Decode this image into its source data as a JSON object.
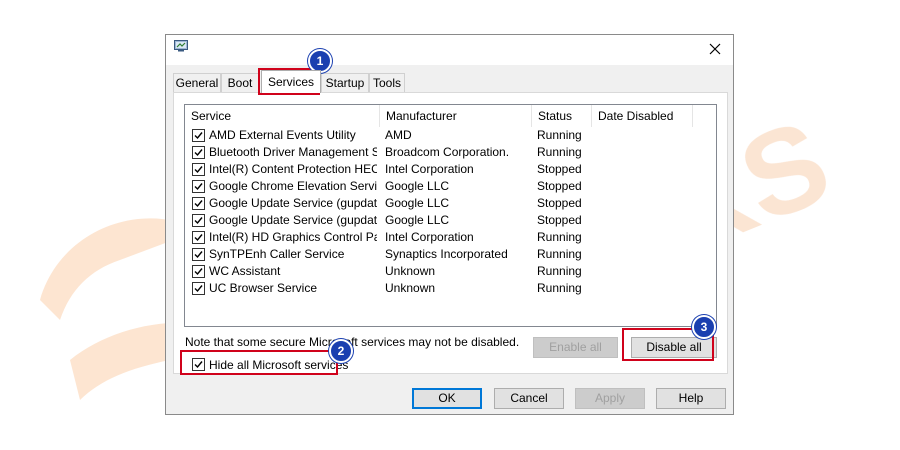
{
  "dialog": {
    "tabs": [
      {
        "label": "General"
      },
      {
        "label": "Boot"
      },
      {
        "label": "Services"
      },
      {
        "label": "Startup"
      },
      {
        "label": "Tools"
      }
    ],
    "columns": [
      "Service",
      "Manufacturer",
      "Status",
      "Date Disabled"
    ],
    "services": [
      {
        "name": "AMD External Events Utility",
        "manufacturer": "AMD",
        "status": "Running",
        "checked": true
      },
      {
        "name": "Bluetooth Driver Management S...",
        "manufacturer": "Broadcom Corporation.",
        "status": "Running",
        "checked": true
      },
      {
        "name": "Intel(R) Content Protection HEC...",
        "manufacturer": "Intel Corporation",
        "status": "Stopped",
        "checked": true
      },
      {
        "name": "Google Chrome Elevation Servic...",
        "manufacturer": "Google LLC",
        "status": "Stopped",
        "checked": true
      },
      {
        "name": "Google Update Service (gupdate)",
        "manufacturer": "Google LLC",
        "status": "Stopped",
        "checked": true
      },
      {
        "name": "Google Update Service (gupdatem)",
        "manufacturer": "Google LLC",
        "status": "Stopped",
        "checked": true
      },
      {
        "name": "Intel(R) HD Graphics Control Pa...",
        "manufacturer": "Intel Corporation",
        "status": "Running",
        "checked": true
      },
      {
        "name": "SynTPEnh Caller Service",
        "manufacturer": "Synaptics Incorporated",
        "status": "Running",
        "checked": true
      },
      {
        "name": "WC Assistant",
        "manufacturer": "Unknown",
        "status": "Running",
        "checked": true
      },
      {
        "name": "UC Browser Service",
        "manufacturer": "Unknown",
        "status": "Running",
        "checked": true
      }
    ],
    "note": "Note that some secure Microsoft services may not be disabled.",
    "hide_ms_label": "Hide all Microsoft services",
    "buttons": {
      "enable_all": "Enable all",
      "disable_all": "Disable all",
      "ok": "OK",
      "cancel": "Cancel",
      "apply": "Apply",
      "help": "Help"
    }
  },
  "annotations": [
    "1",
    "2",
    "3"
  ],
  "watermark": "TRICKS",
  "colors": {
    "highlight": "#d0021b",
    "badge": "#1a3fb0",
    "watermark": "#f7c99a"
  }
}
